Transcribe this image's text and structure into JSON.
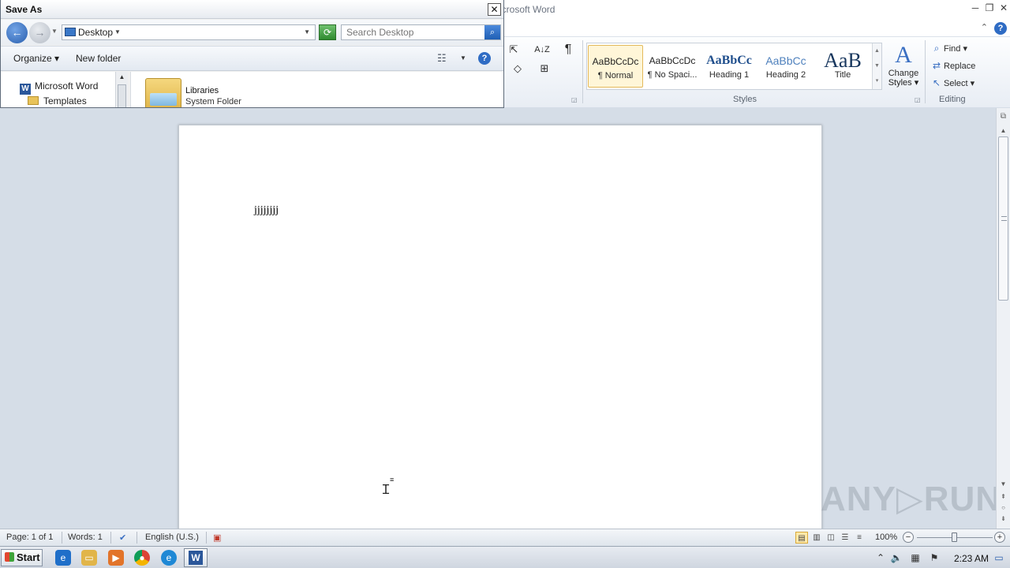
{
  "word_window": {
    "title_partial": "icrosoft Word",
    "controls": {
      "minimize": "─",
      "restore": "❐",
      "close": "✕"
    }
  },
  "ribbon": {
    "paragraph": {
      "sort_icon": "A↓Z",
      "pilcrow": "¶",
      "shading_icon": "◇",
      "borders_icon": "⊞"
    },
    "styles": {
      "group_label": "Styles",
      "items": [
        {
          "preview": "AaBbCcDc",
          "name": "¶ Normal",
          "selected": true
        },
        {
          "preview": "AaBbCcDc",
          "name": "¶ No Spaci..."
        },
        {
          "preview": "AaBbCc",
          "name": "Heading 1"
        },
        {
          "preview": "AaBbCc",
          "name": "Heading 2"
        },
        {
          "preview": "AaB",
          "name": "Title"
        }
      ],
      "change_styles": {
        "icon": "A",
        "label_line1": "Change",
        "label_line2": "Styles ▾"
      }
    },
    "editing": {
      "group_label": "Editing",
      "find": "Find ▾",
      "replace": "Replace",
      "select": "Select ▾"
    }
  },
  "document": {
    "text": "jjjjjjjj",
    "watermark": "ANY▷RUN"
  },
  "status_bar": {
    "page": "Page: 1 of 1",
    "words": "Words: 1",
    "language": "English (U.S.)",
    "zoom": "100%",
    "zoom_level_percent": 100
  },
  "taskbar": {
    "start_label": "Start",
    "clock": "2:23 AM"
  },
  "save_as": {
    "title": "Save As",
    "close": "✕",
    "address": "Desktop",
    "search_placeholder": "Search Desktop",
    "toolbar": {
      "organize": "Organize ▾",
      "new_folder": "New folder"
    },
    "nav_pane": [
      {
        "label": "Microsoft Word",
        "icon": "word-icon"
      },
      {
        "label": "Templates",
        "icon": "folder-icon"
      }
    ],
    "files": [
      {
        "name": "Libraries",
        "type": "System Folder"
      }
    ]
  }
}
